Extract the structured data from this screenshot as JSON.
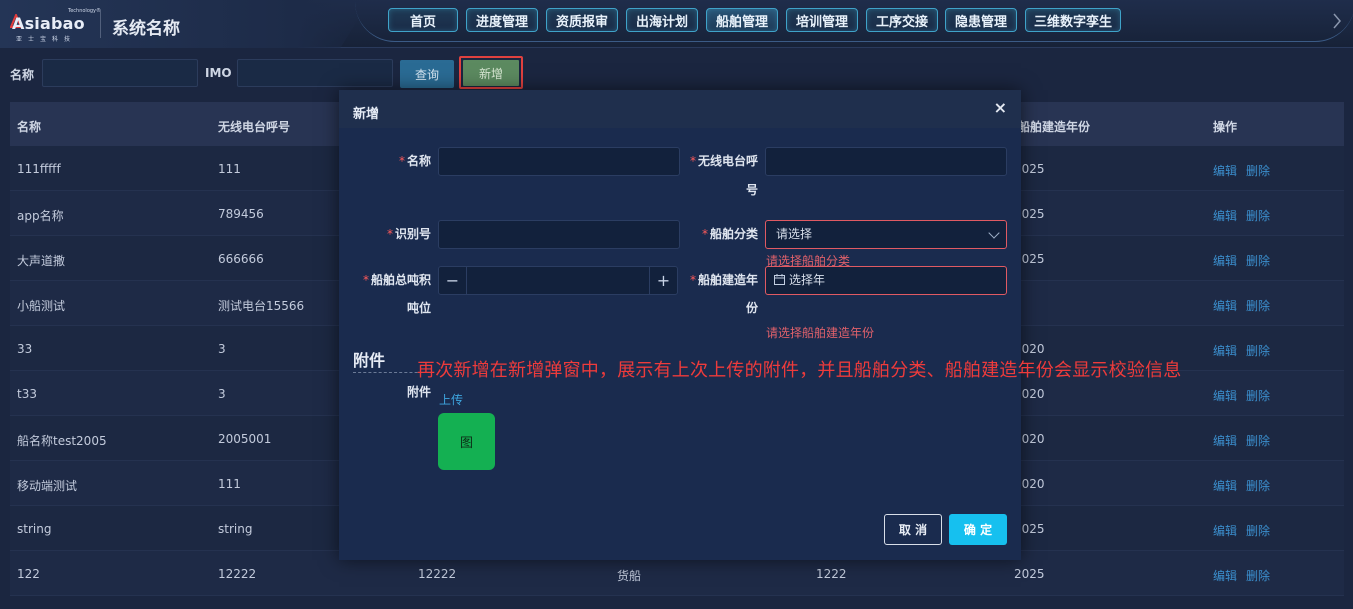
{
  "brand": {
    "logo_word": "Asiabao",
    "logo_sup": "Technology®",
    "logo_cn": "亚士宝科技",
    "system_name": "系统名称"
  },
  "nav": [
    {
      "label": "首页",
      "active": false
    },
    {
      "label": "进度管理",
      "active": false
    },
    {
      "label": "资质报审",
      "active": false
    },
    {
      "label": "出海计划",
      "active": false
    },
    {
      "label": "船舶管理",
      "active": true
    },
    {
      "label": "培训管理",
      "active": false
    },
    {
      "label": "工序交接",
      "active": false
    },
    {
      "label": "隐患管理",
      "active": false
    },
    {
      "label": "三维数字孪生",
      "active": false
    }
  ],
  "search": {
    "name_label": "名称",
    "name_value": "",
    "imo_label": "IMO",
    "imo_value": "",
    "query_button": "查询",
    "add_button": "新增"
  },
  "table": {
    "headers": [
      "名称",
      "无线电台呼号",
      "",
      "",
      "",
      "船舶建造年份",
      "操作"
    ],
    "actions": {
      "edit": "编辑",
      "delete": "删除"
    },
    "rows": [
      [
        "111fffff",
        "111",
        "",
        "",
        "",
        "2025"
      ],
      [
        "app名称",
        "789456",
        "",
        "",
        "",
        "2025"
      ],
      [
        "大声道撒",
        "666666",
        "",
        "",
        "",
        "2025"
      ],
      [
        "小船测试",
        "测试电台15566",
        "",
        "",
        "",
        ""
      ],
      [
        "33",
        "3",
        "",
        "",
        "",
        "2020"
      ],
      [
        "t33",
        "3",
        "",
        "",
        "",
        "2020"
      ],
      [
        "船名称test2005",
        "2005001",
        "",
        "",
        "",
        "2020"
      ],
      [
        "移动端测试",
        "111",
        "",
        "",
        "",
        "2020"
      ],
      [
        "string",
        "string",
        "",
        "",
        "",
        "2025"
      ],
      [
        "122",
        "12222",
        "12222",
        "货船",
        "1222",
        "2025"
      ]
    ]
  },
  "modal": {
    "title": "新增",
    "close": "×",
    "fields": {
      "name_label": "名称",
      "name_value": "",
      "callsign_label_1": "无线电台呼",
      "callsign_label_2": "号",
      "callsign_value": "",
      "id_label": "识别号",
      "id_value": "",
      "category_label": "船舶分类",
      "category_placeholder": "请选择",
      "category_error": "请选择船舶分类",
      "tonnage_label_1": "船舶总吨积",
      "tonnage_label_2": "吨位",
      "tonnage_value": "",
      "tonnage_minus": "−",
      "tonnage_plus": "+",
      "year_label_1": "船舶建造年",
      "year_label_2": "份",
      "year_placeholder": "选择年",
      "year_error": "请选择船舶建造年份"
    },
    "attachments": {
      "section_title": "附件",
      "label": "附件",
      "upload_link": "上传",
      "thumb_text": "图"
    },
    "cancel_button": "取 消",
    "ok_button": "确 定"
  },
  "annotation_text": "再次新增在新增弹窗中，展示有上次上传的附件，并且船舶分类、船舶建造年份会显示校验信息",
  "colors": {
    "accent": "#16c0ef",
    "error": "#e0616b",
    "annotation": "#ee3b3b",
    "link": "#3b8fce",
    "thumb": "#14b052"
  }
}
